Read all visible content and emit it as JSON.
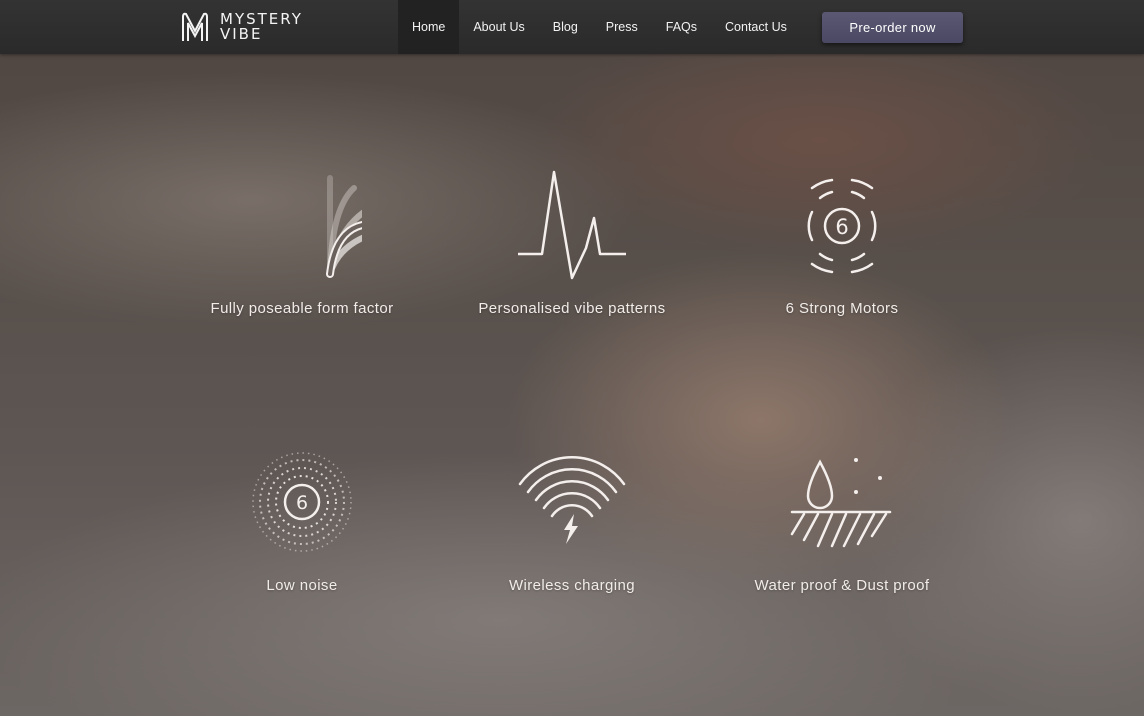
{
  "brand": {
    "line1": "MYSTERY",
    "line2": "VIBE",
    "logo_icon": "m-logo-icon"
  },
  "nav": {
    "items": [
      {
        "label": "Home",
        "active": true
      },
      {
        "label": "About Us",
        "active": false
      },
      {
        "label": "Blog",
        "active": false
      },
      {
        "label": "Press",
        "active": false
      },
      {
        "label": "FAQs",
        "active": false
      },
      {
        "label": "Contact Us",
        "active": false
      }
    ],
    "cta_label": "Pre-order now"
  },
  "features": [
    {
      "label": "Fully poseable form factor",
      "icon": "poseable-icon"
    },
    {
      "label": "Personalised vibe patterns",
      "icon": "pulse-wave-icon"
    },
    {
      "label": "6 Strong Motors",
      "icon": "motors-icon",
      "badge": "6"
    },
    {
      "label": "Low noise",
      "icon": "low-noise-icon",
      "badge": "6"
    },
    {
      "label": "Wireless charging",
      "icon": "wireless-charging-icon"
    },
    {
      "label": "Water proof & Dust proof",
      "icon": "waterproof-icon"
    }
  ],
  "colors": {
    "nav_bg": "#2e2e2e",
    "nav_active_bg": "#222222",
    "cta_bg": "#524f6a",
    "icon_stroke": "#f4efec"
  }
}
